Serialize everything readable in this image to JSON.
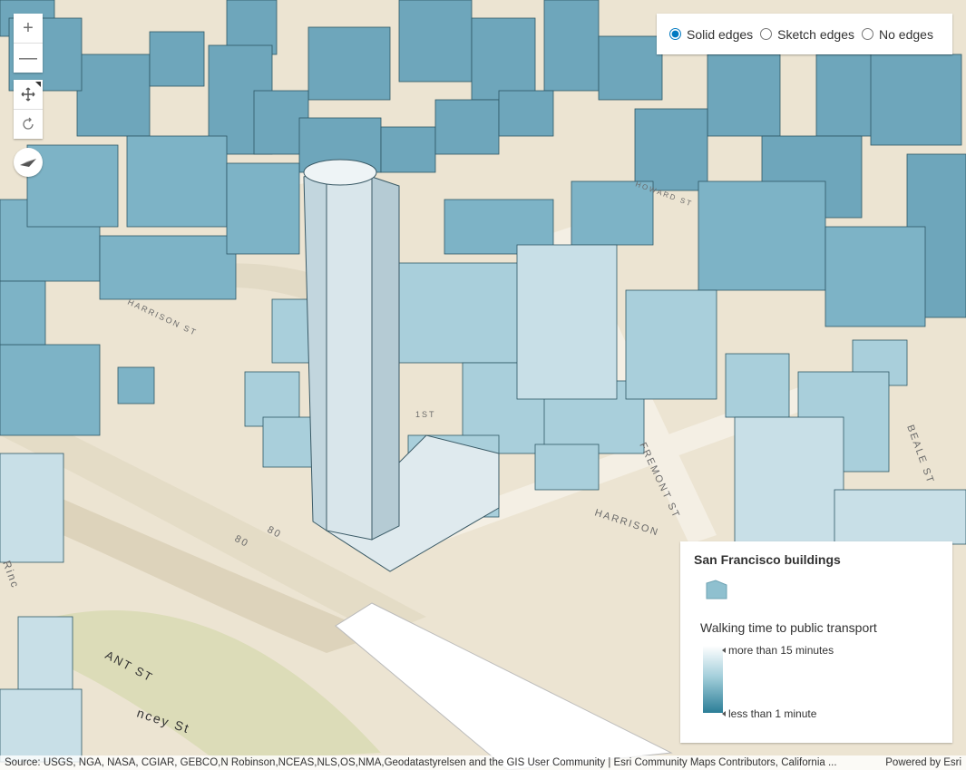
{
  "navigation": {
    "zoom_in": "+",
    "zoom_out": "—",
    "pan_icon": "pan-icon",
    "rotate_icon": "rotate-icon",
    "compass_icon": "compass-icon"
  },
  "edges": {
    "options": [
      {
        "label": "Solid edges",
        "selected": true
      },
      {
        "label": "Sketch edges",
        "selected": false
      },
      {
        "label": "No edges",
        "selected": false
      }
    ]
  },
  "legend": {
    "layer_title": "San Francisco buildings",
    "symbol_color": "#8fc0cf",
    "field_title": "Walking time to public transport",
    "ramp_high_label": "more than 15 minutes",
    "ramp_low_label": "less than 1 minute",
    "ramp_colors": [
      "#ffffff",
      "#a6d0dc",
      "#2b7e97"
    ]
  },
  "map": {
    "street_labels": [
      "HARRISON",
      "FREMONT ST",
      "BEALE ST",
      "HOWARD ST",
      "ANT ST",
      "ncey St",
      "80",
      "80",
      "1ST",
      "HARRISON ST",
      "Rinc"
    ]
  },
  "attribution": {
    "source": "Source: USGS, NGA, NASA, CGIAR, GEBCO,N Robinson,NCEAS,NLS,OS,NMA,Geodatastyrelsen and the GIS User Community | Esri Community Maps Contributors, California ...",
    "powered_by": "Powered by Esri"
  }
}
